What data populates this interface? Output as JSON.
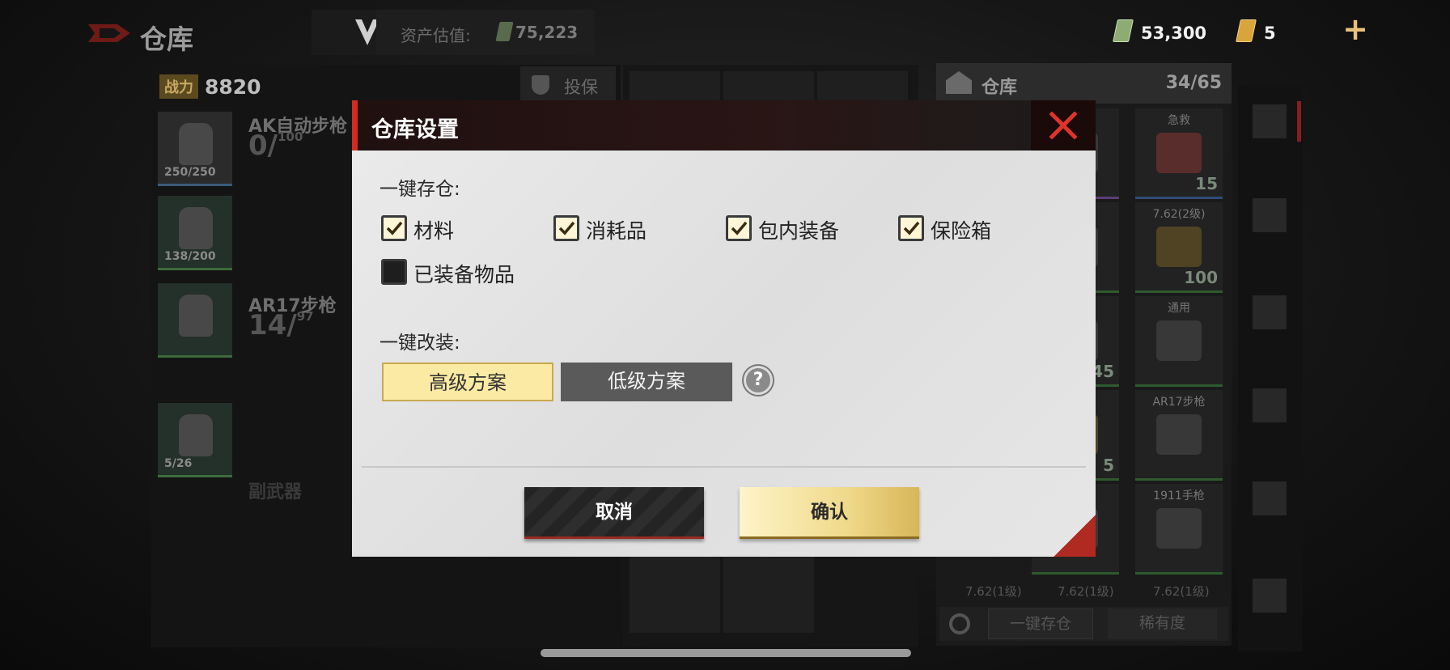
{
  "top": {
    "title": "仓库",
    "asset_label": "资产估值:",
    "asset_value": "75,223",
    "cash_value": "53,300",
    "coupon_value": "5",
    "plus": "+"
  },
  "left": {
    "power_label": "战力",
    "power_value": "8820",
    "insure_label": "投保",
    "slots": [
      {
        "label": "250/250",
        "tone": "blue"
      },
      {
        "label": "138/200",
        "tone": "green"
      },
      {
        "label": "",
        "tone": "green"
      },
      {
        "label": "5/26",
        "tone": "green"
      }
    ],
    "weapon1_name": "AK自动步枪",
    "weapon1_ammo": "0/",
    "weapon1_max": "100",
    "weapon2_name": "AR17步枪",
    "weapon2_ammo": "14/",
    "weapon2_max": "97",
    "sub_weapon": "副武器"
  },
  "warehouse": {
    "title": "仓库",
    "count": "34/65",
    "items": [
      {
        "tag": "急救",
        "qty": "15"
      },
      {
        "tag": "7.62(2级)",
        "qty": "100"
      },
      {
        "tag": "通用",
        "qty": ""
      },
      {
        "tag": "AR17步枪",
        "qty": ""
      },
      {
        "tag": "1911手枪",
        "qty": ""
      }
    ],
    "partial_qty": [
      "45",
      "5"
    ],
    "foot_labels": [
      "7.62(1级)",
      "7.62(1级)",
      "7.62(1级)"
    ],
    "one_key_store": "一键存仓",
    "rarity": "稀有度"
  },
  "modal": {
    "title": "仓库设置",
    "store_section": "一键存仓:",
    "checkboxes": [
      {
        "label": "材料",
        "checked": true
      },
      {
        "label": "消耗品",
        "checked": true
      },
      {
        "label": "包内装备",
        "checked": true
      },
      {
        "label": "保险箱",
        "checked": true
      },
      {
        "label": "已装备物品",
        "checked": false
      }
    ],
    "mod_section": "一键改装:",
    "plan_high": "高级方案",
    "plan_low": "低级方案",
    "help": "?",
    "cancel": "取消",
    "confirm": "确认"
  },
  "colors": {
    "accent_red": "#d12c22",
    "gold": "#efd98a"
  }
}
